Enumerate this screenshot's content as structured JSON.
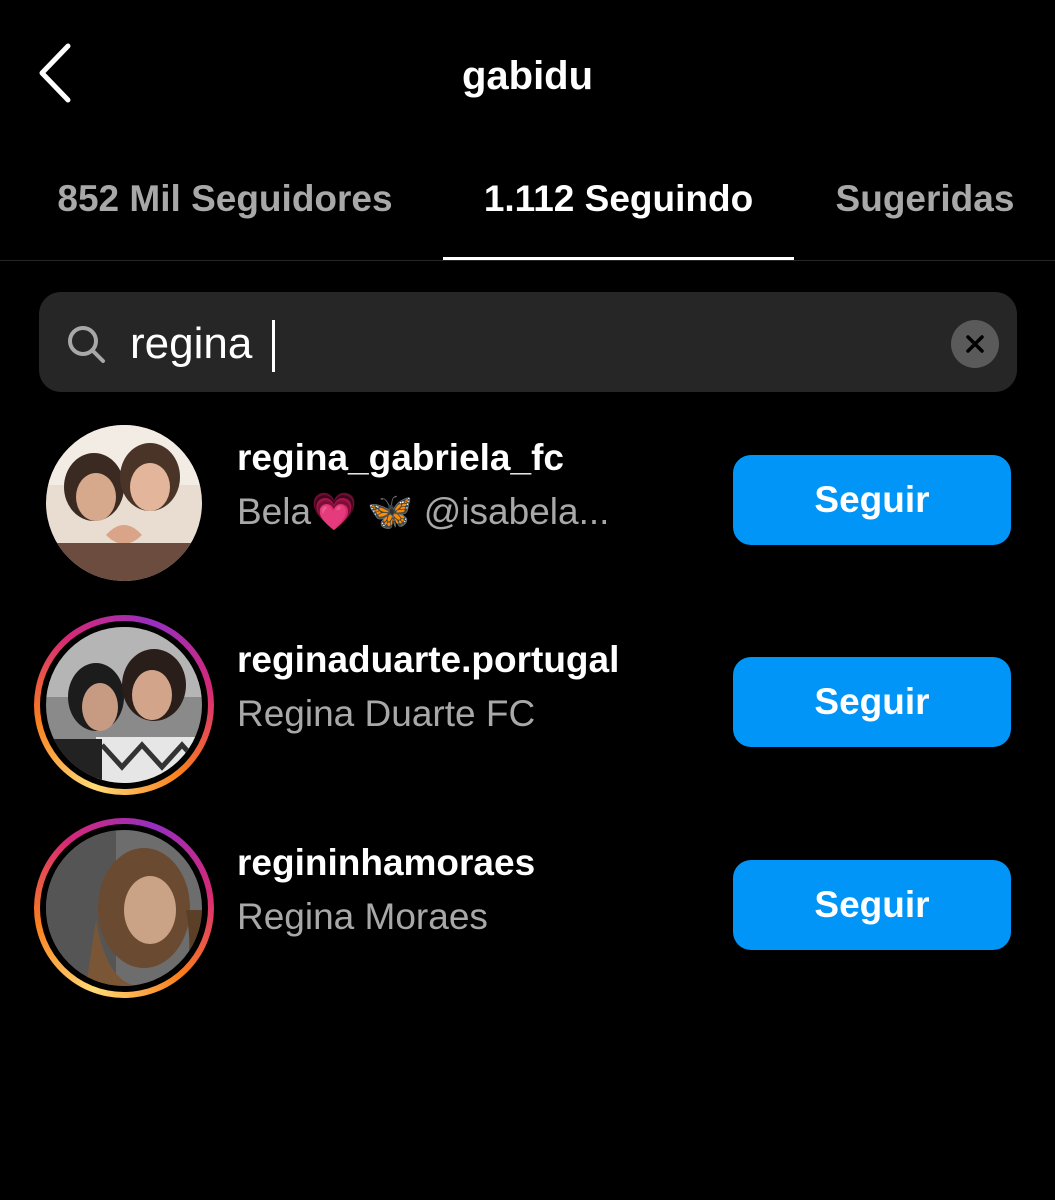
{
  "header": {
    "title": "gabidu",
    "back_icon": "chevron-left-icon"
  },
  "tabs": [
    {
      "label": "852 Mil Seguidores",
      "active": false
    },
    {
      "label": "1.112 Seguindo",
      "active": true
    },
    {
      "label": "Sugeridas",
      "active": false
    }
  ],
  "search": {
    "value": "regina",
    "search_icon": "search-icon",
    "clear_icon": "close-circle-icon"
  },
  "results": [
    {
      "username": "regina_gabriela_fc",
      "subtitle": "Bela💗 🦋   @isabela...",
      "button_label": "Seguir",
      "story_ring": false
    },
    {
      "username": "reginaduarte.portugal",
      "subtitle": "Regina Duarte  FC",
      "button_label": "Seguir",
      "story_ring": true
    },
    {
      "username": "regininhamoraes",
      "subtitle": "Regina Moraes",
      "button_label": "Seguir",
      "story_ring": true
    }
  ],
  "colors": {
    "background": "#000000",
    "accent": "#0095f6",
    "muted_text": "#a8a8a8",
    "search_bg": "#262626"
  }
}
